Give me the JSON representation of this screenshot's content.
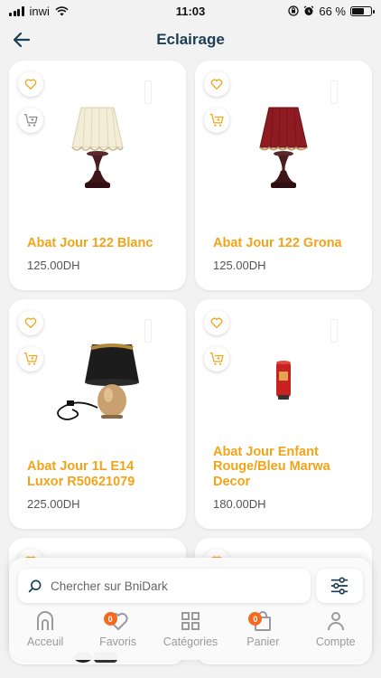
{
  "status_bar": {
    "carrier": "inwi",
    "time": "11:03",
    "battery": "66 %",
    "battery_level": 0.66
  },
  "header": {
    "title": "Eclairage"
  },
  "products": [
    {
      "name": "Abat Jour 122 Blanc",
      "price": "125.00DH",
      "image": "lamp-cream-shade-icon"
    },
    {
      "name": "Abat Jour 122 Grona",
      "price": "125.00DH",
      "image": "lamp-red-shade-icon"
    },
    {
      "name": "Abat Jour 1L E14 Luxor R50621079",
      "price": "225.00DH",
      "image": "lamp-black-shade-icon"
    },
    {
      "name": "Abat Jour Enfant Rouge/Bleu Marwa Decor",
      "price": "180.00DH",
      "image": "lamp-kids-red-icon"
    }
  ],
  "search": {
    "placeholder": "Chercher sur BniDark"
  },
  "nav": {
    "items": [
      {
        "label": "Acceuil",
        "icon": "home-icon"
      },
      {
        "label": "Favoris",
        "icon": "heart-icon",
        "badge": "0"
      },
      {
        "label": "Catégories",
        "icon": "grid-icon"
      },
      {
        "label": "Panier",
        "icon": "bag-icon",
        "badge": "0"
      },
      {
        "label": "Compte",
        "icon": "user-icon"
      }
    ]
  },
  "colors": {
    "accent": "#f2a419",
    "title": "#1b3f54",
    "badge": "#f26b21"
  }
}
